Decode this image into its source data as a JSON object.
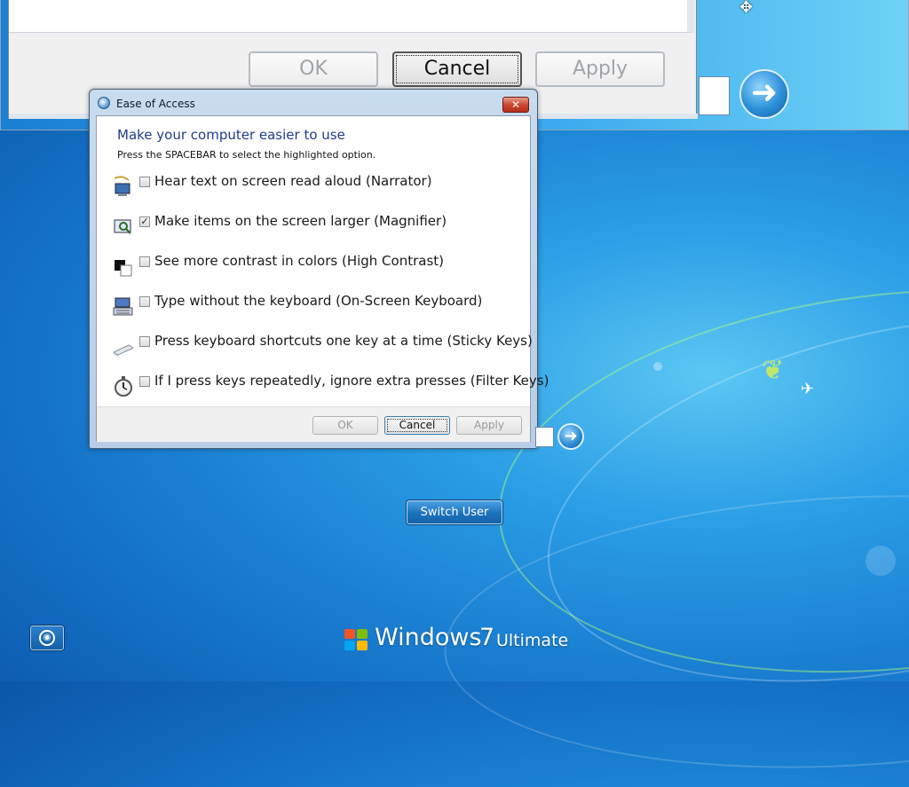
{
  "magnifier_view": {
    "buttons": [
      {
        "label": "OK"
      },
      {
        "label": "Cancel"
      },
      {
        "label": "Apply"
      }
    ]
  },
  "dialog": {
    "title": "Ease of Access",
    "close_glyph": "✕",
    "heading": "Make your computer easier to use",
    "instruction": "Press the SPACEBAR to select the highlighted option.",
    "options": [
      {
        "label": "Hear text on screen read aloud (Narrator)",
        "checked": false,
        "icon": "narrator-icon"
      },
      {
        "label": "Make items on the screen larger (Magnifier)",
        "checked": true,
        "icon": "magnifier-icon"
      },
      {
        "label": "See more contrast in colors (High Contrast)",
        "checked": false,
        "icon": "high-contrast-icon"
      },
      {
        "label": "Type without the keyboard (On-Screen Keyboard)",
        "checked": false,
        "icon": "on-screen-keyboard-icon"
      },
      {
        "label": "Press keyboard shortcuts one key at a time (Sticky Keys)",
        "checked": false,
        "icon": "sticky-keys-icon"
      },
      {
        "label": "If I press keys repeatedly, ignore extra presses (Filter Keys)",
        "checked": false,
        "icon": "filter-keys-icon"
      }
    ],
    "buttons": {
      "ok": "OK",
      "cancel": "Cancel",
      "apply": "Apply"
    }
  },
  "login": {
    "switch_user": "Switch User"
  },
  "branding": {
    "product": "Windows",
    "version": "7",
    "edition": "Ultimate"
  },
  "colors": {
    "heading_blue": "#1e3d8a",
    "close_red": "#c7432b",
    "desktop_blue": "#1a7fd2"
  }
}
